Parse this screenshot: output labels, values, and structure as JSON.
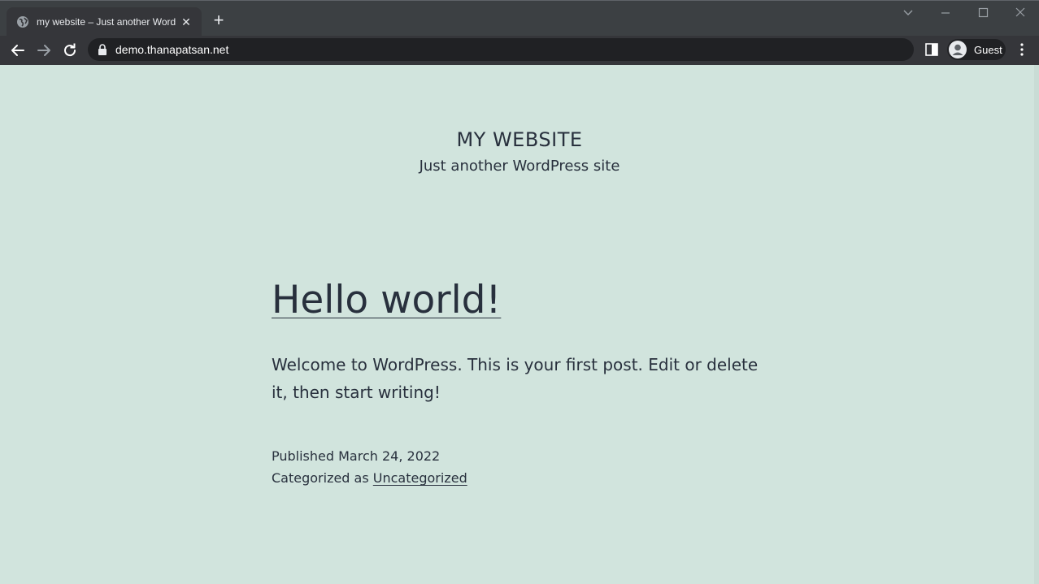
{
  "browser": {
    "tab_title": "my website – Just another WordPress site",
    "new_tab_symbol": "+",
    "close_tab_symbol": "✕",
    "url": "demo.thanapatsan.net",
    "profile_label": "Guest",
    "icons": {
      "favicon": "globe-icon",
      "back": "arrow-left-icon",
      "forward": "arrow-right-icon",
      "reload": "reload-icon",
      "lock": "lock-icon",
      "side_panel": "side-panel-icon",
      "avatar": "person-icon",
      "menu": "kebab-menu-icon"
    },
    "colors": {
      "titlebar": "#3c4043",
      "toolbar": "#35363a",
      "omnibox": "#202124"
    }
  },
  "site": {
    "title": "MY WEBSITE",
    "description": "Just another WordPress site",
    "background": "#d1e4dd",
    "text_color": "#28303d"
  },
  "post": {
    "title": "Hello world!",
    "body": "Welcome to WordPress. This is your first post. Edit or delete it, then start writing!",
    "published_label": "Published",
    "published_date": "March 24, 2022",
    "categorized_label": "Categorized as",
    "category": "Uncategorized"
  }
}
